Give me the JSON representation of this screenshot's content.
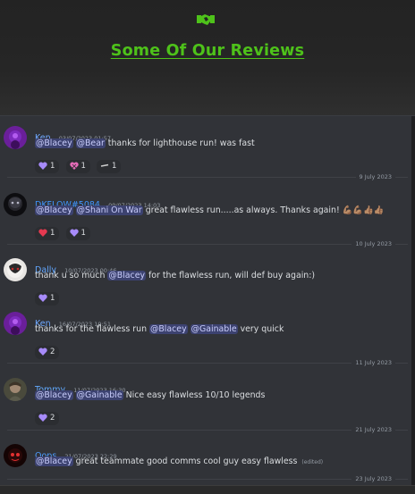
{
  "hero": {
    "title": "Some Of Our Reviews",
    "icon": "handshake-icon",
    "accent": "#4ec21a"
  },
  "colors": {
    "mention_bg": "#3c4270",
    "mention_fg": "#c9cdfb",
    "chat_bg": "#313338"
  },
  "messages": [
    {
      "author": "Ken",
      "author_color": "#6ea8ff",
      "timestamp": "03/07/2023 01:57",
      "mentions": [
        "@Blacey",
        "@Bear"
      ],
      "text": "thanks for lighthouse run! was fast",
      "edited": "",
      "reactions": [
        {
          "icon": "purple-heart-icon",
          "count": "1"
        },
        {
          "icon": "pink-heart-icon",
          "count": "1"
        },
        {
          "icon": "dash-emoji-icon",
          "count": "1"
        }
      ]
    },
    {
      "author": "DKFLOW#5084",
      "author_color": "#3f96ff",
      "timestamp": "09/07/2023 14:03",
      "mentions": [
        "@Blacey",
        "@Shani On War"
      ],
      "text": "great flawless run.....as always.  Thanks again! 💪🏽💪🏽👍🏽👍🏽",
      "edited": "",
      "reactions": [
        {
          "icon": "red-heart-icon",
          "count": "1"
        },
        {
          "icon": "purple-heart-icon",
          "count": "1"
        }
      ]
    },
    {
      "author": "Dally",
      "author_color": "#63a8ff",
      "timestamp": "10/07/2023 00:46",
      "text_before": "thank u so much ",
      "mentions": [
        "@Blacey"
      ],
      "text": " for the flawless run, will def buy again:)",
      "edited": "",
      "reactions": [
        {
          "icon": "purple-heart-icon",
          "count": "1"
        }
      ]
    },
    {
      "author": "Ken",
      "author_color": "#6ea8ff",
      "timestamp": "16/07/2023 19:51",
      "text_before": "thanks for the flawless run ",
      "mentions": [
        "@Blacey",
        "@Gainable"
      ],
      "text": "very quick",
      "edited": "",
      "reactions": [
        {
          "icon": "purple-heart-icon",
          "count": "2"
        }
      ]
    },
    {
      "author": "Tommy",
      "author_color": "#62aaff",
      "timestamp": "11/07/2023 16:30",
      "mentions": [
        "@Blacey",
        "@Gainable"
      ],
      "text": "Nice easy flawless 10/10 legends",
      "edited": "",
      "reactions": [
        {
          "icon": "purple-heart-icon",
          "count": "2"
        }
      ]
    },
    {
      "author": "Oops",
      "author_color": "#4c9dff",
      "timestamp": "21/07/2023 22:29",
      "mentions": [
        "@Blacey"
      ],
      "text": "great teammate good comms cool guy easy flawless",
      "edited": "(edited)",
      "reactions": []
    }
  ],
  "dividers": [
    "9 July 2023",
    "10 July 2023",
    "11 July 2023",
    "21 July 2023",
    "23 July 2023"
  ]
}
